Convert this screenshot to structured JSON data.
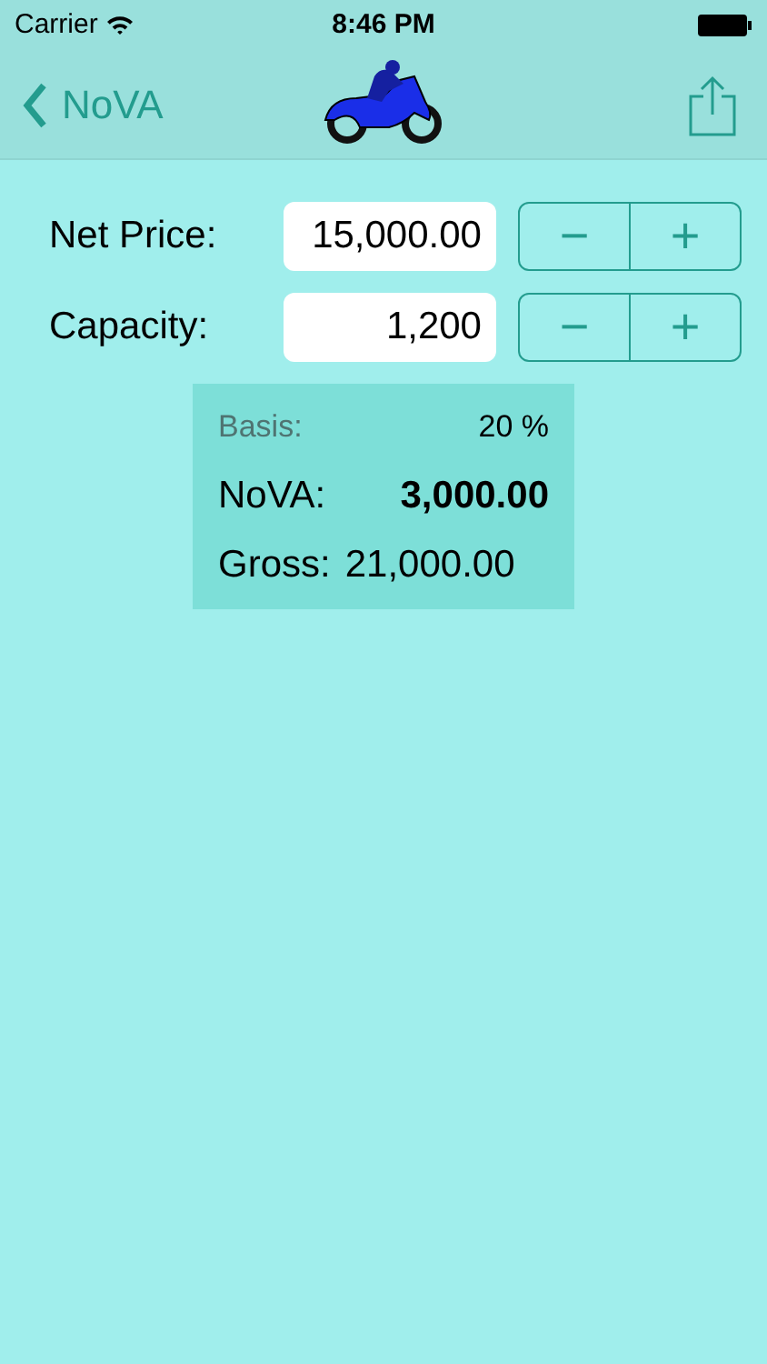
{
  "status_bar": {
    "carrier": "Carrier",
    "time": "8:46 PM"
  },
  "nav_bar": {
    "back_label": "NoVA"
  },
  "inputs": [
    {
      "label": "Net Price:",
      "value": "15,000.00",
      "minus": "−",
      "plus": "+"
    },
    {
      "label": "Capacity:",
      "value": "1,200",
      "minus": "−",
      "plus": "+"
    }
  ],
  "results": [
    {
      "kind": "basis",
      "label": "Basis:",
      "value": "20 %"
    },
    {
      "kind": "main",
      "label": "NoVA:",
      "value": "3,000.00"
    },
    {
      "kind": "plain",
      "label": "Gross:",
      "value": "21,000.00"
    }
  ]
}
